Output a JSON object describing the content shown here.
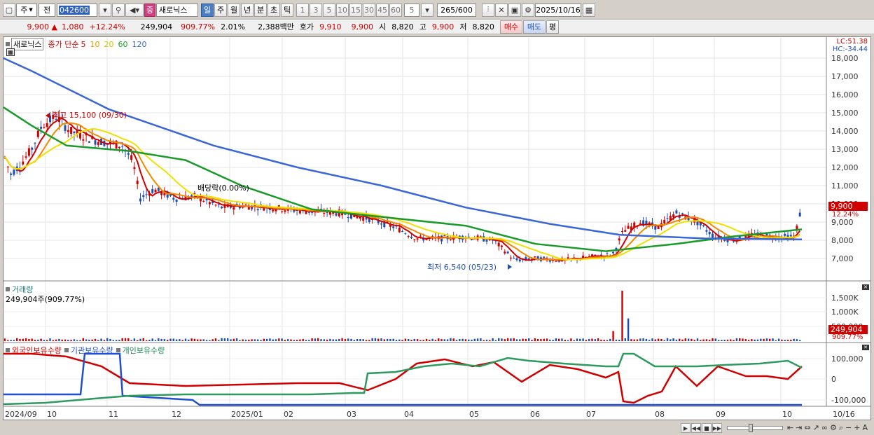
{
  "toolbar": {
    "market": "주",
    "mode": "전",
    "code": "042600",
    "name": "새로닉스",
    "sig": "중",
    "periods": [
      "일",
      "주",
      "월",
      "년",
      "분",
      "초",
      "틱"
    ],
    "intervals": [
      "1",
      "3",
      "5",
      "10",
      "15",
      "30",
      "45",
      "60"
    ],
    "interval_val": "5",
    "count": "265",
    "count_max": "/600",
    "date": "2025/10/16"
  },
  "quote": {
    "price": "9,900",
    "arrow": "▲",
    "change": "1,080",
    "rate": "+12.24%",
    "volume": "249,904",
    "vol_rate": "909.77%",
    "turnover": "2.01%",
    "amount": "2,388백만",
    "ask_label": "호가",
    "ask1": "9,910",
    "ask2": "9,900",
    "open_l": "시",
    "open": "8,820",
    "high_l": "고",
    "high": "9,900",
    "low_l": "저",
    "low": "8,820",
    "buy": "매수",
    "sell": "매도",
    "eval": "평"
  },
  "legend": {
    "name": "새로닉스",
    "ma_label": "종가 단순",
    "ma": [
      "5",
      "10",
      "20",
      "60",
      "120"
    ]
  },
  "annot": {
    "high": "최고 15,100 (09/30)",
    "low": "최저 6,540 (05/23)",
    "div": "배당락(0.00%)",
    "lc": "LC:51.38",
    "hc": "HC:-34.44",
    "price_tag": "9,900",
    "rate_tag": "12.24%"
  },
  "price_axis": [
    "18,000",
    "17,000",
    "16,000",
    "15,000",
    "14,000",
    "13,000",
    "12,000",
    "11,000",
    "10,000",
    "9,000",
    "8,000",
    "7,000"
  ],
  "volume": {
    "label": "거래량",
    "value": "249,904주(909.77%)",
    "axis": [
      "1,500K",
      "1,000K",
      "500,000"
    ],
    "tag": "249,904",
    "tag2": "909.77%"
  },
  "holdings": {
    "s1": "외국인보유수량",
    "s2": "기관보유수량",
    "s3": "개인보유수량",
    "axis": [
      "100,000",
      "0",
      "-100,000"
    ]
  },
  "x_axis": [
    "2024/09",
    "10",
    "11",
    "12",
    "2025/01",
    "02",
    "03",
    "04",
    "05",
    "06",
    "07",
    "08",
    "09",
    "10",
    "10/16"
  ],
  "colors": {
    "up": "#d00000",
    "down": "#1f4fb4",
    "ma5": "#d00000",
    "ma10": "#f08a00",
    "ma20": "#f0e000",
    "ma60": "#1a9a2a",
    "ma120": "#3a66d8"
  }
}
